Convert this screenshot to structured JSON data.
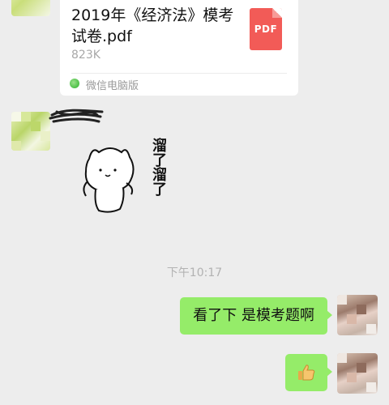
{
  "file_card": {
    "name": "2019年《经济法》模考试卷.pdf",
    "size": "823K",
    "icon_label": "PDF",
    "icon_color": "#f25b57",
    "source": "微信电脑版"
  },
  "sticker": {
    "text": "溜了溜了",
    "icon": "cat-sticker"
  },
  "timestamp": "下午10:17",
  "messages": [
    {
      "type": "text",
      "text": "看了下 是模考题啊"
    },
    {
      "type": "emoji",
      "emoji": "👍",
      "icon": "thumbs-up-icon"
    }
  ],
  "colors": {
    "background": "#ededed",
    "bubble_out": "#95ec69",
    "card": "#ffffff"
  }
}
